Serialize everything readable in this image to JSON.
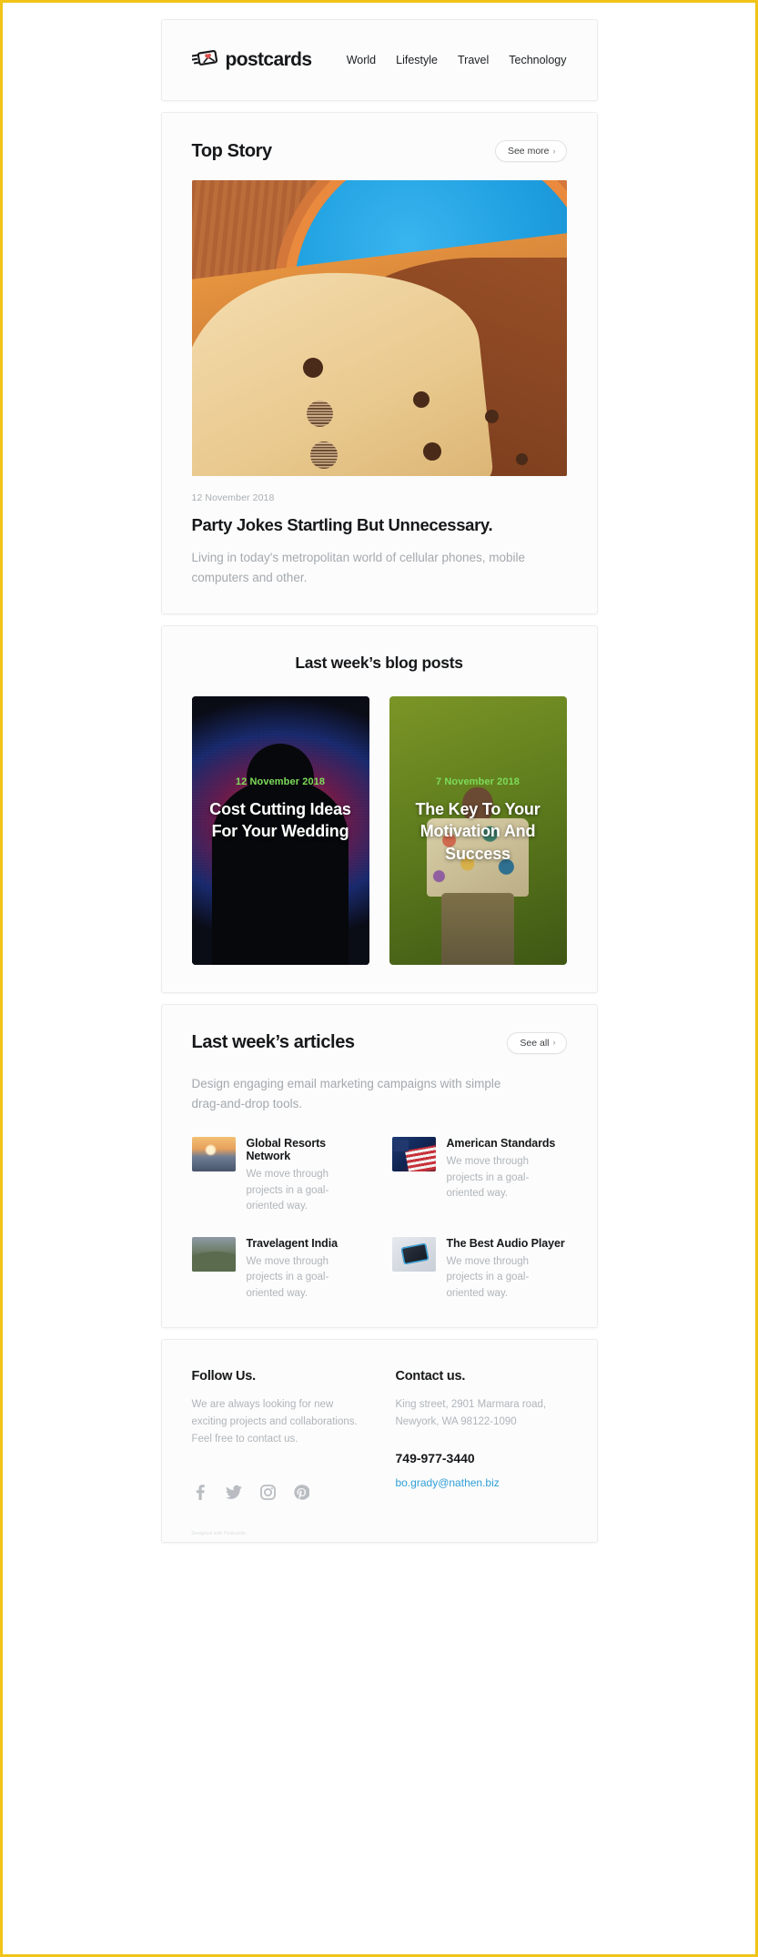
{
  "header": {
    "brand_name": "postcards",
    "logo_icon": "postcard-heart-icon",
    "nav": [
      {
        "label": "World"
      },
      {
        "label": "Lifestyle"
      },
      {
        "label": "Travel"
      },
      {
        "label": "Technology"
      }
    ]
  },
  "top_story": {
    "section_title": "Top Story",
    "see_more_label": "See more",
    "chevron": "›",
    "hero_image_alt": "curved-architecture-photo",
    "date": "12 November 2018",
    "title": "Party Jokes Startling But Unnecessary.",
    "description": "Living in today's metropolitan world of cellular phones, mobile computers and other."
  },
  "blog": {
    "section_title": "Last week’s blog posts",
    "posts": [
      {
        "date": "12 November 2018",
        "title": "Cost Cutting Ideas For Your Wedding",
        "image_alt": "led-screen-silhouette-photo",
        "date_color": "#7ddc5a"
      },
      {
        "date": "7 November 2018",
        "title": "The Key To Your Motivation And Success",
        "image_alt": "man-in-patterned-shirt-photo",
        "date_color": "#7ddc5a"
      }
    ]
  },
  "articles": {
    "section_title": "Last week’s articles",
    "see_all_label": "See all",
    "chevron": "›",
    "lead": "Design engaging email marketing campaigns with simple drag-and-drop tools.",
    "items": [
      {
        "title": "Global Resorts Network",
        "description": "We move through projects in a goal-oriented way.",
        "thumb": "th-sunset",
        "thumb_alt": "sunset-clouds-thumbnail"
      },
      {
        "title": "American Standards",
        "description": "We move through projects in a goal-oriented way.",
        "thumb": "th-flag",
        "thumb_alt": "american-flag-thumbnail"
      },
      {
        "title": "Travelagent India",
        "description": "We move through projects in a goal-oriented way.",
        "thumb": "th-land",
        "thumb_alt": "landscape-thumbnail"
      },
      {
        "title": "The Best Audio Player",
        "description": "We move through projects in a goal-oriented way.",
        "thumb": "th-audio",
        "thumb_alt": "audio-device-thumbnail"
      }
    ]
  },
  "footer": {
    "follow_heading": "Follow Us.",
    "follow_text": "We are always looking for new exciting projects and collaborations. Feel free to contact us.",
    "contact_heading": "Contact us.",
    "address": "King street, 2901 Marmara road, Newyork, WA 98122-1090",
    "phone": "749-977-3440",
    "email": "bo.grady@nathen.biz",
    "socials": [
      {
        "name": "facebook-icon"
      },
      {
        "name": "twitter-icon"
      },
      {
        "name": "instagram-icon"
      },
      {
        "name": "pinterest-icon"
      }
    ],
    "credit": "Designed with Postcards"
  },
  "colors": {
    "accent_link": "#2f9fd6",
    "page_border": "#f0c419",
    "post_date": "#7ddc5a",
    "muted_text": "#a4a9ae"
  }
}
